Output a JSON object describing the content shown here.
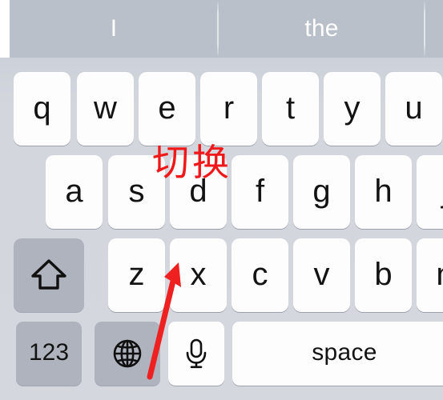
{
  "app": {
    "name": "ios-keyboard-screenshot",
    "background_color": "#ffffff"
  },
  "prediction_bar": {
    "background_color": "#b9c0c9",
    "text_color": "#ffffff",
    "suggestions": [
      {
        "label": "I"
      },
      {
        "label": "the"
      },
      {
        "label": ""
      }
    ]
  },
  "keyboard": {
    "background_color": "#d2d5dd",
    "key_color": "#fdfdfd",
    "modifier_key_color": "#aeb3bd",
    "key_text_color": "#131313",
    "rows": [
      {
        "name": "row-1",
        "keys": [
          {
            "label": "q",
            "name": "key-q",
            "type": "letter"
          },
          {
            "label": "w",
            "name": "key-w",
            "type": "letter"
          },
          {
            "label": "e",
            "name": "key-e",
            "type": "letter"
          },
          {
            "label": "r",
            "name": "key-r",
            "type": "letter"
          },
          {
            "label": "t",
            "name": "key-t",
            "type": "letter"
          },
          {
            "label": "y",
            "name": "key-y",
            "type": "letter"
          },
          {
            "label": "u",
            "name": "key-u",
            "type": "letter"
          }
        ]
      },
      {
        "name": "row-2",
        "keys": [
          {
            "label": "a",
            "name": "key-a",
            "type": "letter"
          },
          {
            "label": "s",
            "name": "key-s",
            "type": "letter"
          },
          {
            "label": "d",
            "name": "key-d",
            "type": "letter"
          },
          {
            "label": "f",
            "name": "key-f",
            "type": "letter"
          },
          {
            "label": "g",
            "name": "key-g",
            "type": "letter"
          },
          {
            "label": "h",
            "name": "key-h",
            "type": "letter"
          },
          {
            "label": "j",
            "name": "key-j",
            "type": "letter"
          }
        ]
      },
      {
        "name": "row-3",
        "keys": [
          {
            "label": "",
            "name": "key-shift",
            "type": "modifier",
            "icon": "shift-arrow-icon"
          },
          {
            "label": "z",
            "name": "key-z",
            "type": "letter"
          },
          {
            "label": "x",
            "name": "key-x",
            "type": "letter"
          },
          {
            "label": "c",
            "name": "key-c",
            "type": "letter"
          },
          {
            "label": "v",
            "name": "key-v",
            "type": "letter"
          },
          {
            "label": "b",
            "name": "key-b",
            "type": "letter"
          },
          {
            "label": "n",
            "name": "key-n",
            "type": "letter"
          }
        ]
      },
      {
        "name": "row-4",
        "keys": [
          {
            "label": "123",
            "name": "key-numbers",
            "type": "modifier"
          },
          {
            "label": "",
            "name": "key-globe",
            "type": "modifier",
            "icon": "globe-icon"
          },
          {
            "label": "",
            "name": "key-dictation",
            "type": "letter",
            "icon": "microphone-icon"
          },
          {
            "label": "space",
            "name": "key-space",
            "type": "letter"
          }
        ]
      }
    ]
  },
  "annotations": {
    "color": "#f01818",
    "text": "切换",
    "arrow": {
      "name": "pointer-arrow",
      "points_to": "key-globe"
    }
  }
}
